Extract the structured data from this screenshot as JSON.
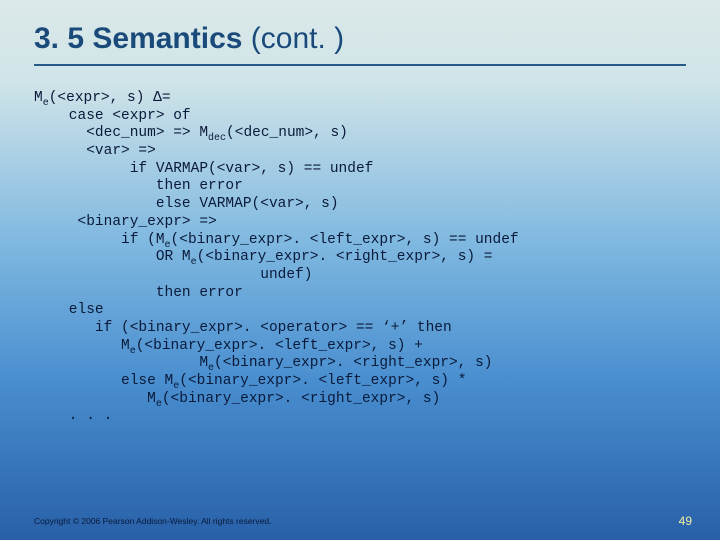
{
  "title_main": "3. 5 Semantics",
  "title_paren": " (cont. )",
  "code_lines": [
    "M<sub>e</sub>(&lt;expr&gt;, s) &#916;=",
    "    case &lt;expr&gt; of",
    "      &lt;dec_num&gt; =&gt; M<sub>dec</sub>(&lt;dec_num&gt;, s)",
    "      &lt;var&gt; =&gt;",
    "           if VARMAP(&lt;var&gt;, s) == undef",
    "              then error",
    "              else VARMAP(&lt;var&gt;, s)",
    "     &lt;binary_expr&gt; =&gt;",
    "          if (M<sub>e</sub>(&lt;binary_expr&gt;. &lt;left_expr&gt;, s) == undef",
    "              OR M<sub>e</sub>(&lt;binary_expr&gt;. &lt;right_expr&gt;, s) =",
    "                          undef)",
    "              then error",
    "    else",
    "       if (&lt;binary_expr&gt;. &lt;operator&gt; == &#8216;+&#8217; then",
    "          M<sub>e</sub>(&lt;binary_expr&gt;. &lt;left_expr&gt;, s) +",
    "                   M<sub>e</sub>(&lt;binary_expr&gt;. &lt;right_expr&gt;, s)",
    "          else M<sub>e</sub>(&lt;binary_expr&gt;. &lt;left_expr&gt;, s) *",
    "             M<sub>e</sub>(&lt;binary_expr&gt;. &lt;right_expr&gt;, s)",
    "    . . ."
  ],
  "footer": "Copyright © 2006 Pearson Addison-Wesley. All rights reserved.",
  "page_number": "49"
}
